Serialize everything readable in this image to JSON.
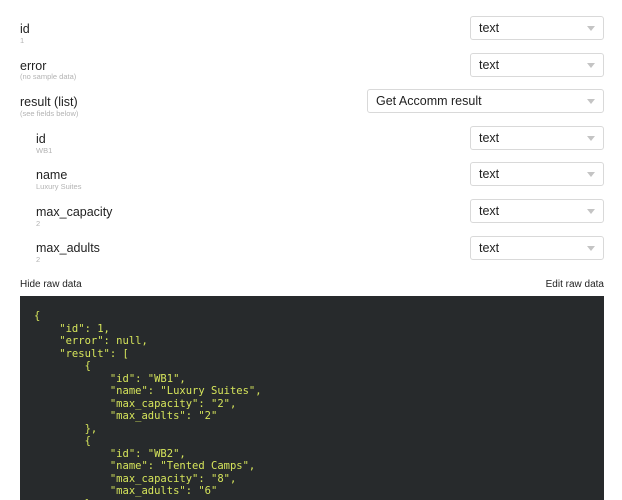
{
  "fields": [
    {
      "name": "id",
      "sample": "1",
      "type": "text"
    },
    {
      "name": "error",
      "sample": "(no sample data)",
      "type": "text"
    },
    {
      "name": "result (list)",
      "sample": "(see fields below)",
      "type": "Get Accomm result"
    },
    {
      "name": "id",
      "sample": "WB1",
      "type": "text"
    },
    {
      "name": "name",
      "sample": "Luxury Suites",
      "type": "text"
    },
    {
      "name": "max_capacity",
      "sample": "2",
      "type": "text"
    },
    {
      "name": "max_adults",
      "sample": "2",
      "type": "text"
    }
  ],
  "raw": {
    "hide_label": "Hide raw data",
    "edit_label": "Edit raw data",
    "json_text": "{\n    \"id\": 1,\n    \"error\": null,\n    \"result\": [\n        {\n            \"id\": \"WB1\",\n            \"name\": \"Luxury Suites\",\n            \"max_capacity\": \"2\",\n            \"max_adults\": \"2\"\n        },\n        {\n            \"id\": \"WB2\",\n            \"name\": \"Tented Camps\",\n            \"max_capacity\": \"8\",\n            \"max_adults\": \"6\"\n        },"
  },
  "colors": {
    "code_background": "#272a2c",
    "code_text": "#d6e55b"
  }
}
